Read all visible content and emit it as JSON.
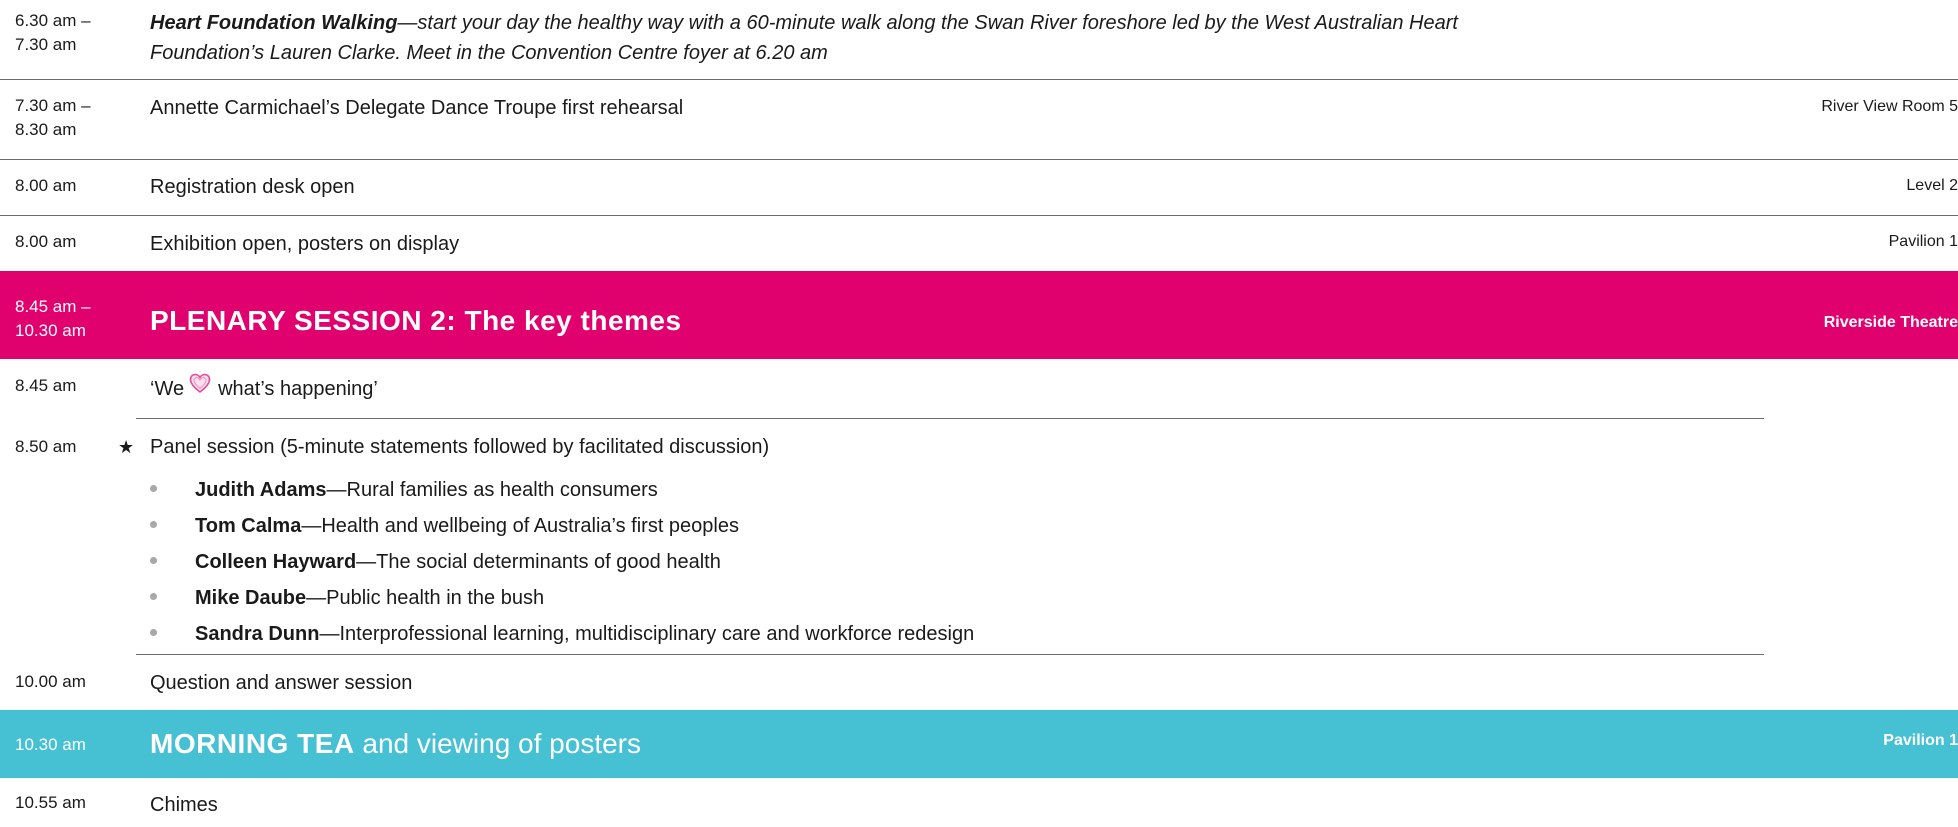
{
  "rows": {
    "walk": {
      "time": "6.30 am –\n7.30 am",
      "title": "Heart Foundation Walking",
      "description": "—start your day the healthy way with a 60-minute walk along the Swan River foreshore led by the West Australian Heart",
      "description2": "Foundation’s Lauren Clarke. Meet in the Convention Centre foyer at 6.20 am"
    },
    "dance": {
      "time": "7.30 am –\n8.30 am",
      "text": "Annette Carmichael’s Delegate Dance Troupe first rehearsal",
      "venue": "River View Room 5"
    },
    "registration": {
      "time": "8.00 am",
      "text": "Registration desk open",
      "venue": "Level 2"
    },
    "exhibition": {
      "time": "8.00 am",
      "text": "Exhibition open, posters on display",
      "venue": "Pavilion 1"
    },
    "plenary": {
      "time": "8.45 am –\n10.30 am",
      "title": "PLENARY SESSION 2: The key themes",
      "venue": "Riverside Theatre"
    },
    "welcome": {
      "time": "8.45 am",
      "text_before": "‘We",
      "text_after": "what’s happening’"
    },
    "panel": {
      "time": "8.50 am",
      "star": "★",
      "text": "Panel session (5-minute statements followed by facilitated discussion)",
      "speakers": [
        {
          "name": "Judith Adams",
          "topic": "—Rural families as health consumers"
        },
        {
          "name": "Tom Calma",
          "topic": "—Health and wellbeing of Australia’s first peoples"
        },
        {
          "name": "Colleen Hayward",
          "topic": "—The social determinants of good health"
        },
        {
          "name": "Mike Daube",
          "topic": "—Public health in the bush"
        },
        {
          "name": "Sandra Dunn",
          "topic": "—Interprofessional learning, multidisciplinary care and workforce redesign"
        }
      ]
    },
    "qa": {
      "time": "10.00 am",
      "text": "Question and answer session"
    },
    "tea": {
      "time": "10.30 am",
      "title_bold": "MORNING TEA",
      "title_rest": " and viewing of posters",
      "venue": "Pavilion 1"
    },
    "chimes": {
      "time": "10.55 am",
      "text": "Chimes"
    }
  },
  "colors": {
    "plenary_band": "#e0006e",
    "tea_band": "#46c0d3",
    "heart": "#e54c9a"
  },
  "icons": {
    "heart": "heart-icon",
    "star": "star-icon",
    "bullet": "bullet-icon"
  }
}
